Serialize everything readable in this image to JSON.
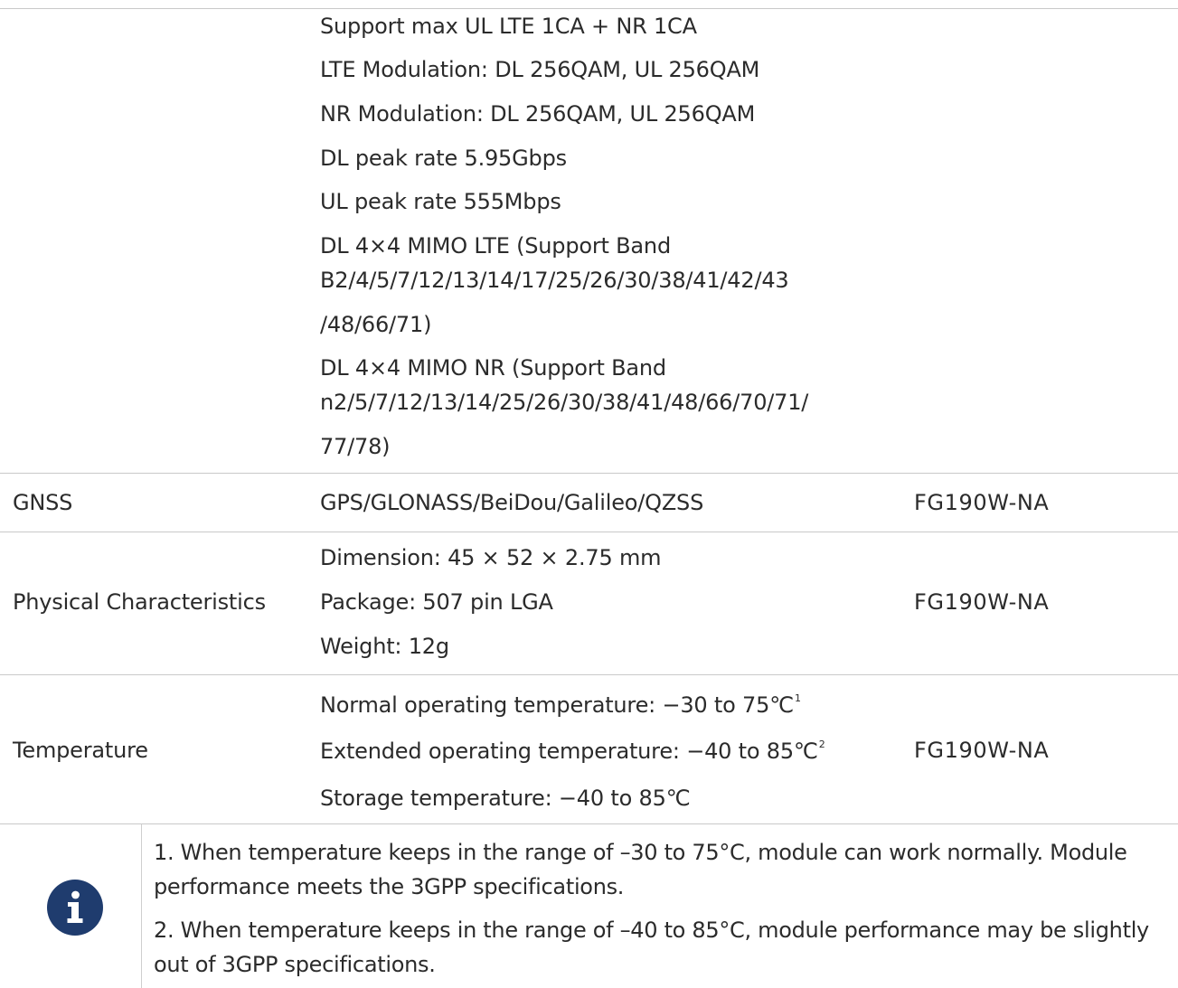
{
  "cap_rows": {
    "features": [
      "Support max UL LTE 1CA + NR 1CA",
      "LTE Modulation: DL 256QAM, UL 256QAM",
      "NR Modulation: DL 256QAM, UL 256QAM",
      "DL peak rate 5.95Gbps",
      "UL peak rate 555Mbps",
      "DL 4×4 MIMO LTE (Support Band",
      "B2/4/5/7/12/13/14/17/25/26/30/38/41/42/43",
      "/48/66/71)",
      "DL 4×4 MIMO NR (Support Band",
      "n2/5/7/12/13/14/25/26/30/38/41/48/66/70/71/",
      "77/78)"
    ]
  },
  "gnss": {
    "label": "GNSS",
    "value": "GPS/GLONASS/BeiDou/Galileo/QZSS",
    "model": "FG190W-NA"
  },
  "physical": {
    "label": "Physical Characteristics",
    "dimension": "Dimension: 45 × 52 × 2.75 mm",
    "package": "Package: 507 pin LGA",
    "weight": "Weight: 12g",
    "model": "FG190W-NA"
  },
  "temperature": {
    "label": "Temperature",
    "normal": "Normal operating temperature: −30 to 75℃",
    "normal_sup": "1",
    "extended": "Extended operating temperature: −40 to 85℃",
    "extended_sup": "2",
    "storage": "Storage temperature: −40 to 85℃",
    "model": "FG190W-NA"
  },
  "notes": {
    "icon": "info-icon",
    "icon_color": "#1f3c6e",
    "note1_line1": "1. When temperature keeps in the range of –30 to 75°C, module can work normally. Module",
    "note1_line2": "performance meets the 3GPP specifications.",
    "note2_line1": "2. When temperature keeps in the range of –40 to 85°C, module performance may be slightly",
    "note2_line2": "out of 3GPP specifications."
  }
}
